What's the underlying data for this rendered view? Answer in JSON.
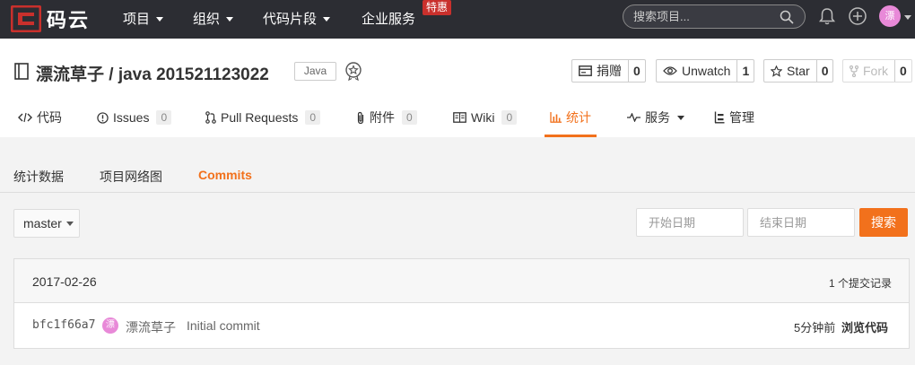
{
  "topnav": {
    "logo_text": "码云",
    "items": [
      {
        "label": "项目"
      },
      {
        "label": "组织"
      },
      {
        "label": "代码片段"
      },
      {
        "label": "企业服务"
      }
    ],
    "promo_badge": "特惠",
    "search_placeholder": "搜索项目...",
    "user_avatar_char": "漂",
    "icons": [
      "bell-icon",
      "plus-circle-icon",
      "search-icon"
    ]
  },
  "project": {
    "title": "漂流草子 / java 201521123022",
    "language": "Java",
    "actions": [
      {
        "label": "捐赠",
        "count": "0",
        "icon": "donate-icon"
      },
      {
        "label": "Unwatch",
        "count": "1",
        "icon": "eye-icon"
      },
      {
        "label": "Star",
        "count": "0",
        "icon": "star-icon"
      },
      {
        "label": "Fork",
        "count": "0",
        "icon": "fork-icon"
      }
    ],
    "tabs": [
      {
        "label": "代码",
        "icon": "code-icon"
      },
      {
        "label": "Issues",
        "count": "0",
        "icon": "info-icon"
      },
      {
        "label": "Pull Requests",
        "count": "0",
        "icon": "pull-request-icon"
      },
      {
        "label": "附件",
        "count": "0",
        "icon": "paperclip-icon"
      },
      {
        "label": "Wiki",
        "count": "0",
        "icon": "book-icon"
      },
      {
        "label": "统计",
        "icon": "bar-chart-icon",
        "active": true
      },
      {
        "label": "服务",
        "icon": "pulse-icon"
      },
      {
        "label": "管理",
        "icon": "settings-icon"
      }
    ]
  },
  "subnav": {
    "items": [
      {
        "label": "统计数据"
      },
      {
        "label": "项目网络图"
      },
      {
        "label": "Commits",
        "active": true
      }
    ]
  },
  "filter": {
    "branch": "master",
    "start_placeholder": "开始日期",
    "end_placeholder": "结束日期",
    "search_label": "搜索"
  },
  "commits": {
    "date": "2017-02-26",
    "total": "1 个提交记录",
    "rows": [
      {
        "sha": "bfc1f66a7",
        "avatar_char": "漂",
        "author": "漂流草子",
        "message": "Initial commit",
        "time": "5分钟前",
        "browse_label": "浏览代码"
      }
    ]
  },
  "colors": {
    "accent": "#f2711c",
    "topbar": "#2c2d33",
    "avatar": "#e889d8"
  }
}
